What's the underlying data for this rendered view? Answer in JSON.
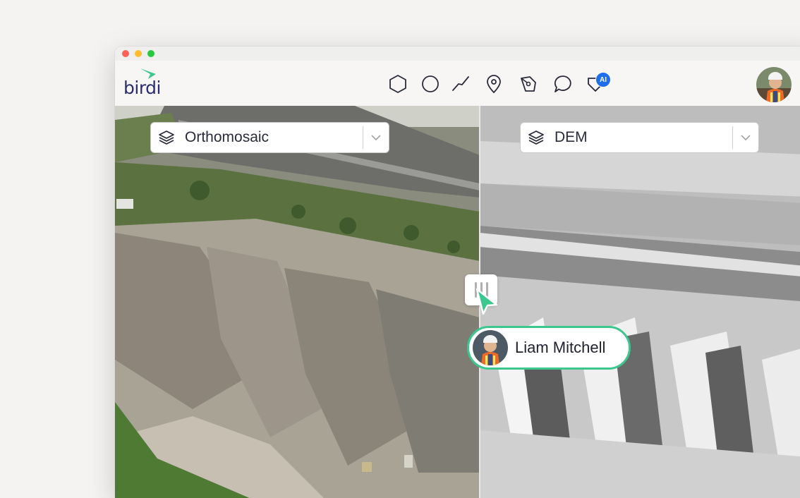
{
  "app": {
    "brand": "birdi",
    "colors": {
      "brand_navy": "#2b2d6e",
      "brand_green": "#3cc78f",
      "ai_blue": "#1f6fe8"
    }
  },
  "toolbar": {
    "tools": [
      {
        "icon": "polygon-icon"
      },
      {
        "icon": "circle-icon"
      },
      {
        "icon": "polyline-icon"
      },
      {
        "icon": "location-pin-icon"
      },
      {
        "icon": "pen-tool-icon"
      },
      {
        "icon": "comment-icon"
      },
      {
        "icon": "ai-tag-icon"
      }
    ],
    "ai_badge": "AI"
  },
  "left_panel": {
    "layer_select": "Orthomosaic"
  },
  "right_panel": {
    "layer_select": "DEM"
  },
  "collaborator": {
    "name": "Liam Mitchell"
  }
}
